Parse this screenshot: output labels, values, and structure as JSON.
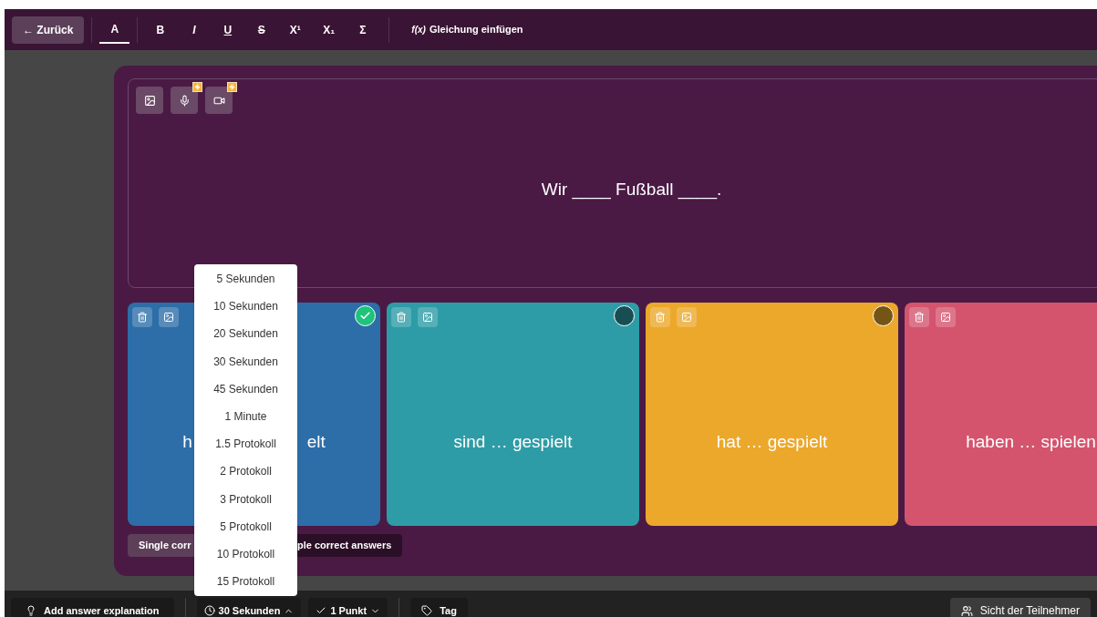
{
  "toolbar": {
    "back": "← Zurück",
    "format_buttons": [
      {
        "kind": "color",
        "label": "A",
        "selected": true
      },
      {
        "kind": "bold",
        "label": "B",
        "selected": false
      },
      {
        "kind": "italic",
        "label": "I",
        "selected": false
      },
      {
        "kind": "underline",
        "label": "U",
        "selected": false
      },
      {
        "kind": "strike",
        "label": "S",
        "selected": false
      },
      {
        "kind": "plain",
        "label": "X¹",
        "selected": false
      },
      {
        "kind": "plain",
        "label": "X₁",
        "selected": false
      },
      {
        "kind": "plain",
        "label": "Σ",
        "selected": false
      }
    ],
    "equation": {
      "icon": "f(x)",
      "label": "Gleichung einfügen"
    }
  },
  "question": {
    "media_buttons": [
      {
        "kind": "image",
        "badge": false
      },
      {
        "kind": "mic",
        "badge": true
      },
      {
        "kind": "video",
        "badge": true
      }
    ],
    "text": "Wir ____ Fußball ____."
  },
  "answers": [
    {
      "color": "#2d6ea9",
      "text_parts": [
        "h",
        "elt"
      ],
      "correct": true
    },
    {
      "color": "#2e9ca6",
      "text_parts": [
        "sind … gespielt"
      ],
      "correct": false
    },
    {
      "color": "#eca82b",
      "text_parts": [
        "hat … gespielt"
      ],
      "correct": false
    },
    {
      "color": "#d4546e",
      "text_parts": [
        "haben … spielen"
      ]
    }
  ],
  "answer_mode": [
    {
      "label": "Single corr",
      "selected": true
    },
    {
      "label": "ple correct answers",
      "selected": false
    }
  ],
  "bottom_bar": {
    "explanation": "Add answer explanation",
    "time": "30 Sekunden",
    "points": "1 Punkt",
    "tag": "Tag",
    "participant_view": "Sicht der Teilnehmer"
  },
  "time_menu": [
    "5 Sekunden",
    "10 Sekunden",
    "20 Sekunden",
    "30 Sekunden",
    "45 Sekunden",
    "1 Minute",
    "1.5 Protokoll",
    "2 Protokoll",
    "3 Protokoll",
    "5 Protokoll",
    "10 Protokoll",
    "15 Protokoll"
  ]
}
